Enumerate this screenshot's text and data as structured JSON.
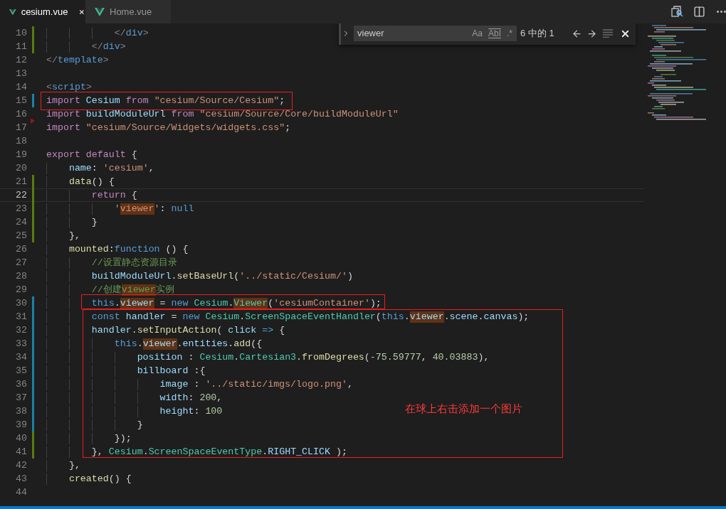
{
  "tabs": [
    {
      "label": "cesium.vue",
      "selected": true
    },
    {
      "label": "Home.vue",
      "selected": false
    }
  ],
  "find": {
    "value": "viewer",
    "options": [
      {
        "label": "Aa",
        "kind": "plain"
      },
      {
        "label": "AbI",
        "kind": "framed"
      },
      {
        "label": ".*",
        "kind": "plain"
      }
    ],
    "count": "6 中的 1"
  },
  "lines": [
    {
      "number": "10",
      "gutter": {
        "kind": "bar",
        "color": "#587c0c"
      },
      "current": false,
      "tokens": [
        {
          "kind": "tagp",
          "t": "            </"
        },
        {
          "kind": "tag",
          "t": "div"
        },
        {
          "kind": "tagp",
          "t": ">"
        }
      ]
    },
    {
      "number": "11",
      "gutter": {
        "kind": "bar",
        "color": "#587c0c"
      },
      "current": false,
      "tokens": [
        {
          "kind": "tagp",
          "t": "        </"
        },
        {
          "kind": "tag",
          "t": "div"
        },
        {
          "kind": "tagp",
          "t": ">"
        }
      ]
    },
    {
      "number": "12",
      "current": false,
      "tokens": [
        {
          "kind": "tagp",
          "t": "</"
        },
        {
          "kind": "tag",
          "t": "template"
        },
        {
          "kind": "tagp",
          "t": ">"
        }
      ]
    },
    {
      "number": "13",
      "current": false
    },
    {
      "number": "14",
      "current": false,
      "tokens": [
        {
          "kind": "tagp",
          "t": "<"
        },
        {
          "kind": "tag",
          "t": "script"
        },
        {
          "kind": "tagp",
          "t": ">"
        }
      ]
    },
    {
      "number": "15",
      "gutter": {
        "kind": "bar",
        "color": "#1b81a8"
      },
      "current": false,
      "tokens": [
        {
          "kind": "kw",
          "t": "import "
        },
        {
          "kind": "var",
          "t": "Cesium "
        },
        {
          "kind": "kw",
          "t": "from "
        },
        {
          "kind": "str",
          "t": "\"cesium/Source/Cesium\""
        },
        {
          "kind": "p",
          "t": ";"
        }
      ]
    },
    {
      "number": "16",
      "current": false,
      "tokens": [
        {
          "kind": "kw",
          "t": "import "
        },
        {
          "kind": "var",
          "t": "buildModuleUrl "
        },
        {
          "kind": "kw",
          "t": "from "
        },
        {
          "kind": "str",
          "t": "\"cesium/Source/Core/buildModuleUrl\""
        }
      ]
    },
    {
      "number": "17",
      "gutter": {
        "kind": "triangle",
        "color": "#94151b"
      },
      "current": false,
      "tokens": [
        {
          "kind": "kw",
          "t": "import "
        },
        {
          "kind": "str",
          "t": "\"cesium/Source/Widgets/widgets.css\""
        },
        {
          "kind": "p",
          "t": ";"
        }
      ]
    },
    {
      "number": "18",
      "current": false
    },
    {
      "number": "19",
      "current": false,
      "tokens": [
        {
          "kind": "kw",
          "t": "export default "
        },
        {
          "kind": "p",
          "t": "{"
        }
      ]
    },
    {
      "number": "20",
      "current": false,
      "tokens": [
        {
          "kind": "var",
          "t": "    name"
        },
        {
          "kind": "p",
          "t": ": "
        },
        {
          "kind": "str",
          "t": "'cesium'"
        },
        {
          "kind": "p",
          "t": ","
        }
      ]
    },
    {
      "number": "21",
      "gutter": {
        "kind": "bar",
        "color": "#587c0c"
      },
      "current": false,
      "tokens": [
        {
          "kind": "fn",
          "t": "    data"
        },
        {
          "kind": "p",
          "t": "() {"
        }
      ]
    },
    {
      "number": "22",
      "gutter": {
        "kind": "bar",
        "color": "#587c0c"
      },
      "current": true,
      "tokens": [
        {
          "kind": "kw",
          "t": "        return "
        },
        {
          "kind": "p",
          "t": "{"
        }
      ]
    },
    {
      "number": "23",
      "gutter": {
        "kind": "bar",
        "color": "#587c0c"
      },
      "current": false,
      "tokens": [
        {
          "kind": "str",
          "t": "            '"
        },
        {
          "kind": "str",
          "t": "viewer",
          "match": true
        },
        {
          "kind": "str",
          "t": "'"
        },
        {
          "kind": "p",
          "t": ": "
        },
        {
          "kind": "st",
          "t": "null"
        }
      ]
    },
    {
      "number": "24",
      "gutter": {
        "kind": "bar",
        "color": "#587c0c"
      },
      "current": false,
      "tokens": [
        {
          "kind": "p",
          "t": "        }"
        }
      ]
    },
    {
      "number": "25",
      "gutter": {
        "kind": "bar",
        "color": "#587c0c"
      },
      "current": false,
      "tokens": [
        {
          "kind": "p",
          "t": "    },"
        }
      ]
    },
    {
      "number": "26",
      "current": false,
      "tokens": [
        {
          "kind": "fn",
          "t": "    mounted"
        },
        {
          "kind": "p",
          "t": ":"
        },
        {
          "kind": "st",
          "t": "function"
        },
        {
          "kind": "p",
          "t": " () {"
        }
      ]
    },
    {
      "number": "27",
      "current": false,
      "tokens": [
        {
          "kind": "cm",
          "t": "        //设置静态资源目录"
        }
      ]
    },
    {
      "number": "28",
      "current": false,
      "tokens": [
        {
          "kind": "var",
          "t": "        buildModuleUrl"
        },
        {
          "kind": "p",
          "t": "."
        },
        {
          "kind": "fn",
          "t": "setBaseUrl"
        },
        {
          "kind": "p",
          "t": "("
        },
        {
          "kind": "str",
          "t": "'../static/Cesium/'"
        },
        {
          "kind": "p",
          "t": ")"
        }
      ]
    },
    {
      "number": "29",
      "current": false,
      "tokens": [
        {
          "kind": "cm",
          "t": "        //创建"
        },
        {
          "kind": "cm",
          "t": "viewer",
          "match": true
        },
        {
          "kind": "cm",
          "t": "实例"
        }
      ]
    },
    {
      "number": "30",
      "gutter": {
        "kind": "bar",
        "color": "#1b81a8"
      },
      "current": false,
      "tokens": [
        {
          "kind": "st",
          "t": "        this"
        },
        {
          "kind": "p",
          "t": "."
        },
        {
          "kind": "var",
          "t": "viewer",
          "match": true
        },
        {
          "kind": "p",
          "t": " = "
        },
        {
          "kind": "st",
          "t": "new "
        },
        {
          "kind": "type",
          "t": "Cesium"
        },
        {
          "kind": "p",
          "t": "."
        },
        {
          "kind": "type",
          "t": "Viewer",
          "match": true
        },
        {
          "kind": "p",
          "t": "("
        },
        {
          "kind": "str",
          "t": "'cesiumContainer'"
        },
        {
          "kind": "p",
          "t": ");"
        }
      ]
    },
    {
      "number": "31",
      "gutter": {
        "kind": "bar",
        "color": "#1b81a8"
      },
      "current": false,
      "tokens": [
        {
          "kind": "st",
          "t": "        const "
        },
        {
          "kind": "var",
          "t": "handler "
        },
        {
          "kind": "p",
          "t": "= "
        },
        {
          "kind": "st",
          "t": "new "
        },
        {
          "kind": "type",
          "t": "Cesium"
        },
        {
          "kind": "p",
          "t": "."
        },
        {
          "kind": "type",
          "t": "ScreenSpaceEventHandler"
        },
        {
          "kind": "p",
          "t": "("
        },
        {
          "kind": "st",
          "t": "this"
        },
        {
          "kind": "p",
          "t": "."
        },
        {
          "kind": "var",
          "t": "viewer",
          "match": true
        },
        {
          "kind": "p",
          "t": "."
        },
        {
          "kind": "var",
          "t": "scene"
        },
        {
          "kind": "p",
          "t": "."
        },
        {
          "kind": "var",
          "t": "canvas"
        },
        {
          "kind": "p",
          "t": ");"
        }
      ]
    },
    {
      "number": "32",
      "gutter": {
        "kind": "bar",
        "color": "#1b81a8"
      },
      "current": false,
      "tokens": [
        {
          "kind": "var",
          "t": "        handler"
        },
        {
          "kind": "p",
          "t": "."
        },
        {
          "kind": "fn",
          "t": "setInputAction"
        },
        {
          "kind": "p",
          "t": "( "
        },
        {
          "kind": "var",
          "t": "click "
        },
        {
          "kind": "st",
          "t": "=> "
        },
        {
          "kind": "p",
          "t": "{"
        }
      ]
    },
    {
      "number": "33",
      "gutter": {
        "kind": "bar",
        "color": "#1b81a8"
      },
      "current": false,
      "tokens": [
        {
          "kind": "st",
          "t": "            this"
        },
        {
          "kind": "p",
          "t": "."
        },
        {
          "kind": "var",
          "t": "viewer",
          "match": true
        },
        {
          "kind": "p",
          "t": "."
        },
        {
          "kind": "var",
          "t": "entities"
        },
        {
          "kind": "p",
          "t": "."
        },
        {
          "kind": "fn",
          "t": "add"
        },
        {
          "kind": "p",
          "t": "({"
        }
      ]
    },
    {
      "number": "34",
      "gutter": {
        "kind": "bar",
        "color": "#1b81a8"
      },
      "current": false,
      "tokens": [
        {
          "kind": "var",
          "t": "                position "
        },
        {
          "kind": "p",
          "t": ": "
        },
        {
          "kind": "type",
          "t": "Cesium"
        },
        {
          "kind": "p",
          "t": "."
        },
        {
          "kind": "type",
          "t": "Cartesian3"
        },
        {
          "kind": "p",
          "t": "."
        },
        {
          "kind": "fn",
          "t": "fromDegrees"
        },
        {
          "kind": "p",
          "t": "("
        },
        {
          "kind": "num",
          "t": "-75.59777"
        },
        {
          "kind": "p",
          "t": ", "
        },
        {
          "kind": "num",
          "t": "40.03883"
        },
        {
          "kind": "p",
          "t": "),"
        }
      ]
    },
    {
      "number": "35",
      "gutter": {
        "kind": "bar",
        "color": "#1b81a8"
      },
      "current": false,
      "tokens": [
        {
          "kind": "var",
          "t": "                billboard "
        },
        {
          "kind": "p",
          "t": ":{"
        }
      ]
    },
    {
      "number": "36",
      "gutter": {
        "kind": "bar",
        "color": "#1b81a8"
      },
      "current": false,
      "tokens": [
        {
          "kind": "var",
          "t": "                    image "
        },
        {
          "kind": "p",
          "t": ": "
        },
        {
          "kind": "str",
          "t": "'../static/imgs/logo.png'"
        },
        {
          "kind": "p",
          "t": ","
        }
      ]
    },
    {
      "number": "37",
      "gutter": {
        "kind": "bar",
        "color": "#1b81a8"
      },
      "current": false,
      "tokens": [
        {
          "kind": "var",
          "t": "                    width"
        },
        {
          "kind": "p",
          "t": ": "
        },
        {
          "kind": "num",
          "t": "200"
        },
        {
          "kind": "p",
          "t": ","
        }
      ]
    },
    {
      "number": "38",
      "gutter": {
        "kind": "bar",
        "color": "#1b81a8"
      },
      "current": false,
      "tokens": [
        {
          "kind": "var",
          "t": "                    height"
        },
        {
          "kind": "p",
          "t": ": "
        },
        {
          "kind": "num",
          "t": "100"
        }
      ]
    },
    {
      "number": "39",
      "gutter": {
        "kind": "bar",
        "color": "#1b81a8"
      },
      "current": false,
      "tokens": [
        {
          "kind": "p",
          "t": "                }"
        }
      ]
    },
    {
      "number": "40",
      "gutter": {
        "kind": "bar",
        "color": "#587c0c"
      },
      "current": false,
      "tokens": [
        {
          "kind": "p",
          "t": "            });"
        }
      ]
    },
    {
      "number": "41",
      "gutter": {
        "kind": "bar",
        "color": "#587c0c"
      },
      "current": false,
      "tokens": [
        {
          "kind": "p",
          "t": "        }, "
        },
        {
          "kind": "type",
          "t": "Cesium"
        },
        {
          "kind": "p",
          "t": "."
        },
        {
          "kind": "type",
          "t": "ScreenSpaceEventType"
        },
        {
          "kind": "p",
          "t": "."
        },
        {
          "kind": "var",
          "t": "RIGHT_CLICK"
        },
        {
          "kind": "p",
          "t": " );"
        }
      ]
    },
    {
      "number": "42",
      "current": false,
      "tokens": [
        {
          "kind": "p",
          "t": "    },"
        }
      ]
    },
    {
      "number": "43",
      "current": false,
      "tokens": [
        {
          "kind": "fn",
          "t": "    created"
        },
        {
          "kind": "p",
          "t": "() {"
        }
      ]
    },
    {
      "number": "44",
      "current": false
    }
  ],
  "annotation": {
    "note": "在球上右击添加一个图片"
  }
}
